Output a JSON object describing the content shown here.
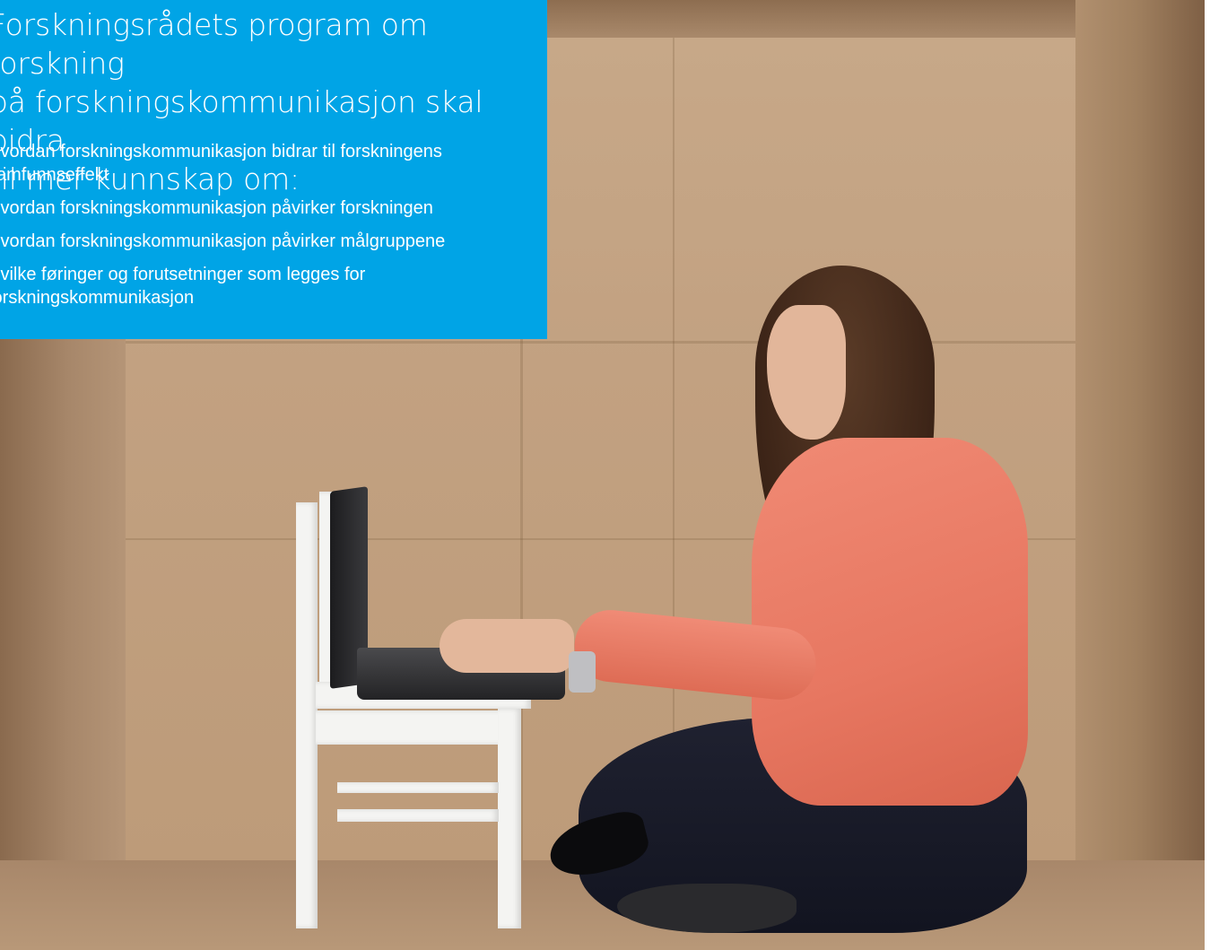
{
  "info_box": {
    "heading": "Forskningsrådets program om forskning på forskningskommunikasjon skal bidra til mer kunnskap om:",
    "heading_lines": [
      "Forskningsrådets program om forskning",
      "på forskningskommunikasjon skal bidra",
      "til mer kunnskap om:"
    ],
    "items": [
      "Hvordan forskningskommunikasjon bidrar til forskningens samfunnseffekt",
      "Hvordan forskningskommunikasjon påvirker forskningen",
      "Hvordan forskningskommunikasjon påvirker målgruppene",
      "Hvilke føringer og forutsetninger som legges for forskningskommunikasjon"
    ],
    "background_color": "#00a4e6",
    "text_color": "#ffffff"
  },
  "photo": {
    "subject": "woman-typing-on-laptop-in-cardboard-box",
    "colors": {
      "cardboard": "#c2a181",
      "shirt": "#e77761",
      "chair": "#f4f4f2"
    }
  }
}
